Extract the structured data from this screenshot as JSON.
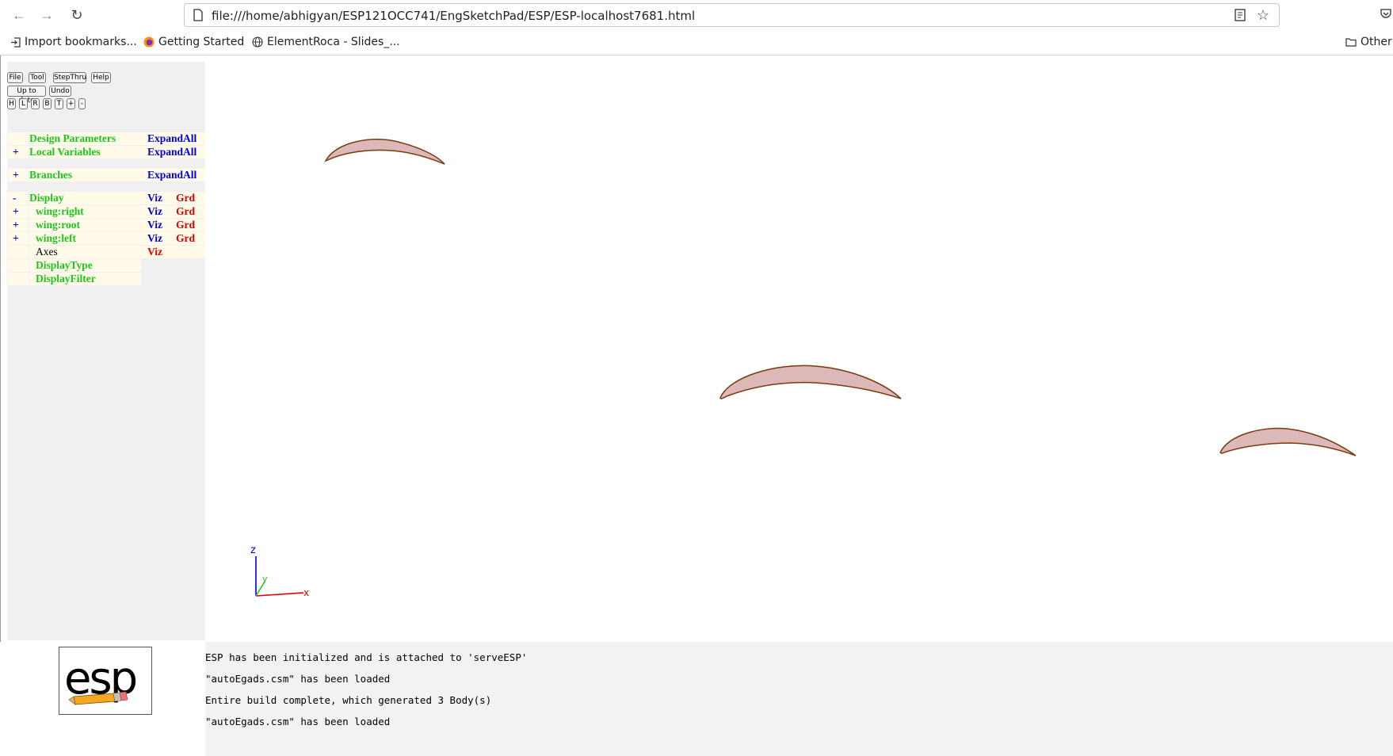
{
  "browser": {
    "url": "file:///home/abhigyan/ESP121OCC741/EngSketchPad/ESP/ESP-localhost7681.html",
    "bookmarks": [
      {
        "label": "Import bookmarks...",
        "icon": "import-icon"
      },
      {
        "label": "Getting Started",
        "icon": "firefox-icon"
      },
      {
        "label": "ElementRoca - Slides_...",
        "icon": "globe-icon"
      }
    ],
    "other_bookmarks": "Other"
  },
  "toolbar": {
    "row1": [
      "File",
      "Tool",
      "StepThru",
      "Help"
    ],
    "row2": [
      "Up to date",
      "Undo"
    ],
    "row3": [
      "H",
      "L",
      "R",
      "B",
      "T",
      "+",
      "-"
    ]
  },
  "tree": {
    "design_parameters": "Design Parameters",
    "local_variables": "Local Variables",
    "branches": "Branches",
    "expand_all": "ExpandAll",
    "plus": "+",
    "minus": "-",
    "display": "Display",
    "viz": "Viz",
    "grd": "Grd",
    "bodies": [
      "wing:right",
      "wing:root",
      "wing:left"
    ],
    "axes": "Axes",
    "display_type": "DisplayType",
    "display_filter": "DisplayFilter"
  },
  "messages": [
    "ESP has been initialized and is attached to 'serveESP'",
    "\"autoEgads.csm\" has been loaded",
    "Entire build complete, which generated 3 Body(s)",
    "\"autoEgads.csm\" has been loaded"
  ],
  "axes_labels": {
    "x": "x",
    "y": "y",
    "z": "z"
  },
  "colors": {
    "airfoil_fill": "#dcb8b8",
    "airfoil_edge": "#7a3a10",
    "tree_green": "#1ec51e",
    "tree_blue": "#0000e0",
    "tree_red": "#e00000"
  }
}
